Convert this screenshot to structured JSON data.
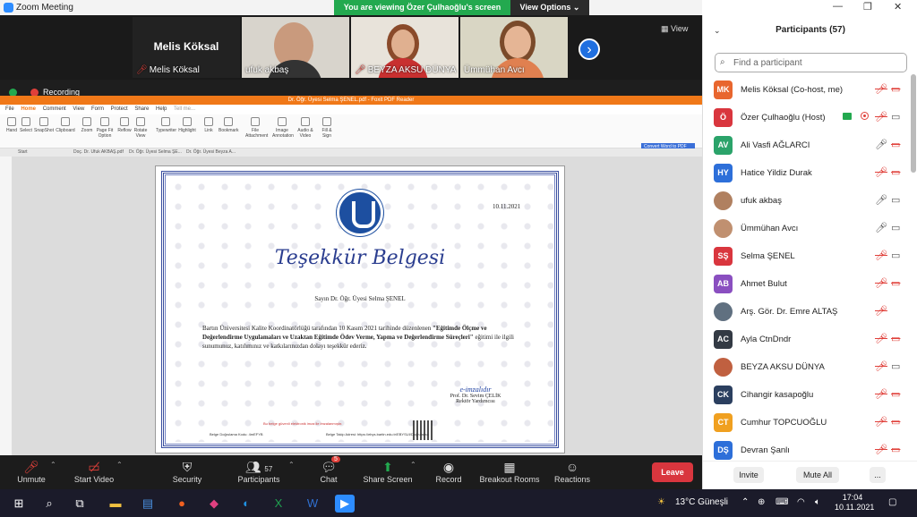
{
  "window": {
    "title": "Zoom Meeting",
    "min": "—",
    "max": "❐",
    "close": "✕"
  },
  "banner": {
    "viewing": "You are viewing Özer Çulhaoğlu's screen",
    "view_options": "View Options ⌄"
  },
  "strip": {
    "view_label": "View",
    "tiles": [
      {
        "name": "Melis Köksal",
        "big": "Melis Köksal"
      },
      {
        "name": "ufuk akbaş"
      },
      {
        "name": "BEYZA AKSU DÜNYA"
      },
      {
        "name": "Ümmühan Avcı"
      }
    ]
  },
  "recording": "Recording",
  "foxit": {
    "title": "Dr. Öğr. Üyesi Selma ŞENEL.pdf - Foxit PDF Reader",
    "menu": [
      "File",
      "Home",
      "Comment",
      "View",
      "Form",
      "Protect",
      "Share",
      "Help",
      "Tell me..."
    ],
    "tools": [
      "Hand",
      "Select",
      "SnapShot",
      "Clipboard",
      "Zoom",
      "Page Fit Option",
      "Reflow",
      "Rotate View",
      "Typewriter",
      "Highlight",
      "Link",
      "Bookmark",
      "File Attachment",
      "Image Annotation",
      "Audio & Video",
      "Fill & Sign"
    ],
    "tabs": [
      "Start",
      "Doç. Dr. Ufuk AKBAŞ.pdf",
      "Dr. Öğr. Üyesi Selma ŞE...",
      "Dr. Öğr. Üyesi Beyza A..."
    ],
    "convert": "Convert Word to PDF"
  },
  "certificate": {
    "date": "10.11.2021",
    "title": "Teşekkür Belgesi",
    "salutation": "Sayın Dr. Öğr. Üyesi Selma ŞENEL",
    "body_plain": "Bartın Üniversitesi Kalite Koordinatörlüğü tarafından 10 Kasım 2021 tarihinde düzenlenen",
    "body_bold": "\"Eğitimde Ölçme ve Değerlendirme Uygulamaları ve Uzaktan Eğitimde Ödev Verme, Yapma ve Değerlendirme Süreçleri\"",
    "body_end": "eğitimi ile ilgili sunumunuz, katılımınız ve katkılarınızdan dolayı teşekkür ederiz.",
    "signature": "e-imzalıdır",
    "signer": "Prof. Dr. Sevim ÇELİK",
    "signer_title": "Rektör Yardımcısı",
    "note": "Bu belge güvenli elektronik imza ile imzalanmıştır.",
    "footer1": "Belge Doğrulama Kodu: 4mEFYB",
    "footer2": "Belge Takip Adresi: https://ebys.bartin.edu.tr/EBYSUI/Doğrulama"
  },
  "toolbar": {
    "unmute": "Unmute",
    "stop_video": "Start Video",
    "security": "Security",
    "participants": "Participants",
    "participants_count": "57",
    "chat": "Chat",
    "chat_badge": "5",
    "share_screen": "Share Screen",
    "record": "Record",
    "breakout": "Breakout Rooms",
    "reactions": "Reactions",
    "leave": "Leave"
  },
  "panel": {
    "title": "Participants (57)",
    "search_placeholder": "Find a participant",
    "invite": "Invite",
    "mute_all": "Mute All",
    "more": "...",
    "participants": [
      {
        "initials": "MK",
        "color": "#e8662e",
        "name": "Melis Köksal (Co-host, me)",
        "mic": "muted",
        "video": "off"
      },
      {
        "initials": "Ö",
        "color": "#d9363e",
        "name": "Özer Çulhaoğlu (Host)",
        "mic": "muted",
        "video": "on",
        "sharing": true
      },
      {
        "initials": "AV",
        "color": "#2ba36a",
        "name": "Ali Vasfi AĞLARCI",
        "mic": "on",
        "video": "off"
      },
      {
        "initials": "HY",
        "color": "#2d6fd9",
        "name": "Hatice Yildiz Durak",
        "mic": "muted",
        "video": "off"
      },
      {
        "initials": "",
        "color": "#b08060",
        "name": "ufuk akbaş",
        "mic": "on",
        "video": "on"
      },
      {
        "initials": "",
        "color": "#c09070",
        "name": "Ümmühan Avcı",
        "mic": "on",
        "video": "on"
      },
      {
        "initials": "SŞ",
        "color": "#d9363e",
        "name": "Selma ŞENEL",
        "mic": "muted",
        "video": "on"
      },
      {
        "initials": "AB",
        "color": "#8a4fc0",
        "name": "Ahmet Bulut",
        "mic": "muted",
        "video": "off"
      },
      {
        "initials": "",
        "color": "#607080",
        "name": "Arş. Gör. Dr. Emre ALTAŞ",
        "mic": "muted",
        "video": "none"
      },
      {
        "initials": "AC",
        "color": "#333a44",
        "name": "Ayla CtnDndr",
        "mic": "muted",
        "video": "off"
      },
      {
        "initials": "",
        "color": "#c06040",
        "name": "BEYZA AKSU DÜNYA",
        "mic": "muted",
        "video": "on"
      },
      {
        "initials": "CK",
        "color": "#2b3f5f",
        "name": "Cihangir kasapoğlu",
        "mic": "muted",
        "video": "off"
      },
      {
        "initials": "CT",
        "color": "#f0a020",
        "name": "Cumhur TOPCUOĞLU",
        "mic": "muted",
        "video": "off"
      },
      {
        "initials": "DŞ",
        "color": "#2d6fd9",
        "name": "Devran Şanlı",
        "mic": "muted",
        "video": "off"
      }
    ]
  },
  "taskbar": {
    "weather": "13°C Güneşli",
    "time": "17:04",
    "date": "10.11.2021"
  }
}
